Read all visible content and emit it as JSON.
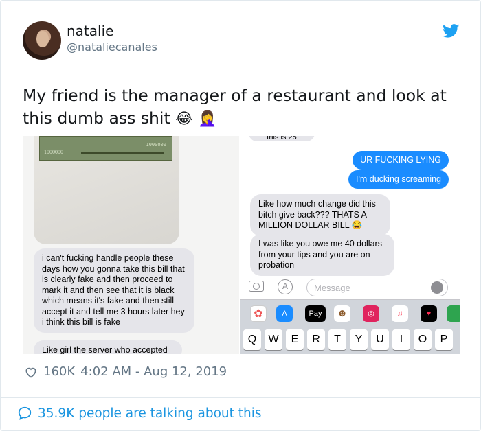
{
  "tweet": {
    "author_name": "natalie",
    "author_handle": "@nataliecanales",
    "text": "My friend is the manager of a restaurant and look at this dumb ass shit",
    "emoji_1": "😂",
    "emoji_2": "🤦‍♀️",
    "likes": "160K",
    "timestamp": "4:02 AM - Aug 12, 2019",
    "talking": "35.9K people are talking about this"
  },
  "media": {
    "left": {
      "bill_note": "1000000",
      "bill_left_text": "1000000",
      "message_1": "i can't fucking handle people these days how you gonna take this bill that is clearly fake and then proceed to mark it and then see that it is black which means it's fake and then still accept it and tell me 3 hours later hey i think this bill is fake",
      "message_2": "Like girl the server who accepted"
    },
    "right": {
      "cut_text": "this is 25",
      "blue_1": "UR FUCKING LYING",
      "blue_2": "I'm ducking screaming",
      "gray_1": "Like how much change did this bitch give back??? THATS A MILLION DOLLAR BILL 😂",
      "gray_2": "I was like you owe me 40 dollars from your tips and you are on probation",
      "message_placeholder": "Message",
      "apple_pay": "Pay",
      "keys": [
        "Q",
        "W",
        "E",
        "R",
        "T",
        "Y",
        "U",
        "I",
        "O",
        "P"
      ]
    }
  },
  "colors": {
    "twitter_blue": "#1da1f2",
    "imessage_blue": "#1a8cff",
    "gray_bubble": "#e5e5ea",
    "muted_text": "#657786"
  },
  "icons": [
    "twitter-bird-icon",
    "heart-icon",
    "reply-bubble-icon",
    "camera-icon",
    "app-store-icon",
    "microphone-icon"
  ]
}
